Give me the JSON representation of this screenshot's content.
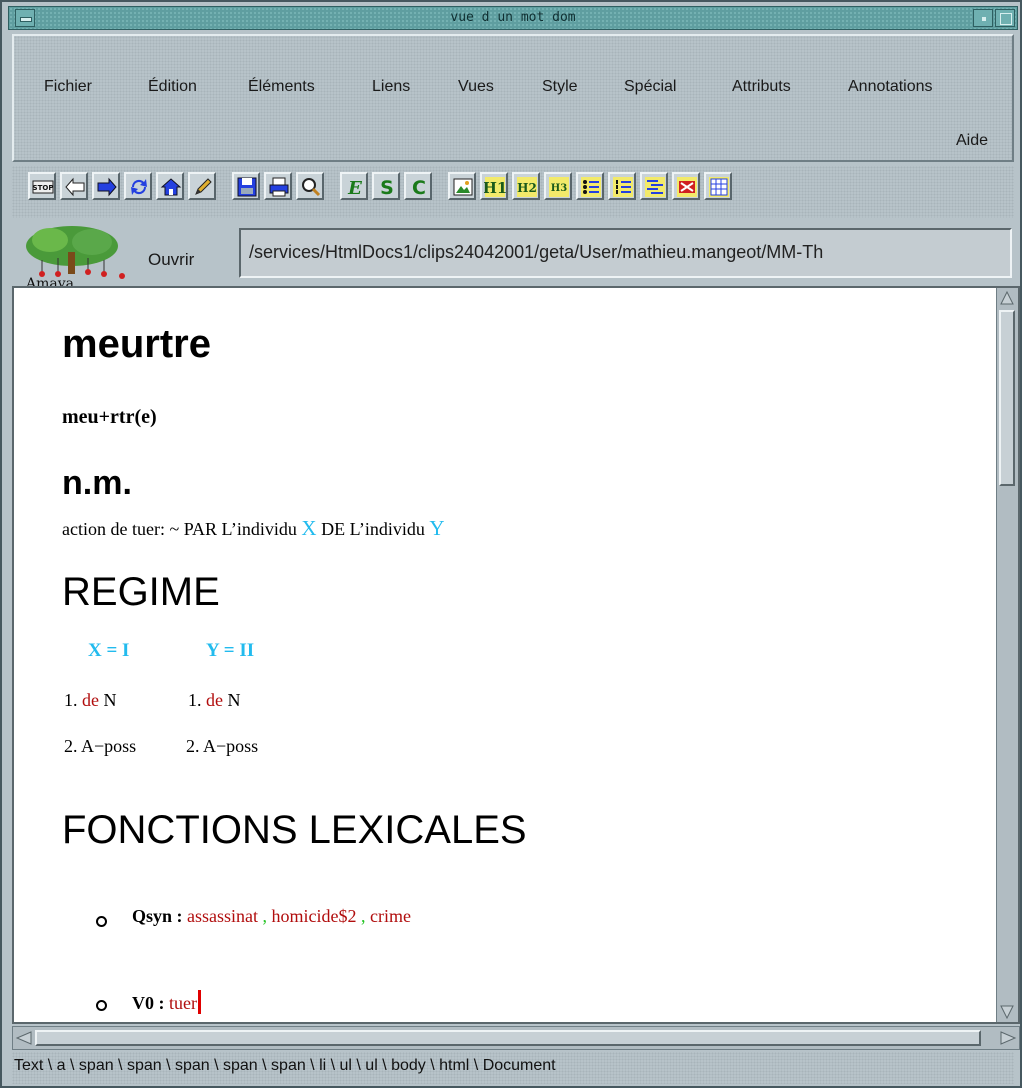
{
  "window": {
    "title": "vue d un mot dom"
  },
  "menubar": {
    "items": [
      "Fichier",
      "Édition",
      "Éléments",
      "Liens",
      "Vues",
      "Style",
      "Spécial",
      "Attributs",
      "Annotations",
      "Aide"
    ]
  },
  "toolbar": {
    "buttons": [
      {
        "icon": "stop-icon",
        "text": "STOP"
      },
      {
        "icon": "back-arrow-icon"
      },
      {
        "icon": "forward-arrow-icon"
      },
      {
        "icon": "reload-icon"
      },
      {
        "icon": "home-icon"
      },
      {
        "icon": "edit-pencil-icon"
      },
      {
        "icon": "save-icon"
      },
      {
        "icon": "print-icon"
      },
      {
        "icon": "find-icon"
      },
      {
        "icon": "emphasis-icon",
        "text": "E"
      },
      {
        "icon": "strong-icon",
        "text": "S"
      },
      {
        "icon": "code-icon",
        "text": "C"
      },
      {
        "icon": "image-icon"
      },
      {
        "icon": "heading1-icon",
        "text": "H1"
      },
      {
        "icon": "heading2-icon",
        "text": "H2"
      },
      {
        "icon": "heading3-icon",
        "text": "H3"
      },
      {
        "icon": "bulleted-list-icon"
      },
      {
        "icon": "numbered-list-icon"
      },
      {
        "icon": "definition-list-icon"
      },
      {
        "icon": "object-icon"
      },
      {
        "icon": "table-icon"
      }
    ]
  },
  "address": {
    "logo_text": "Amaya",
    "open_label": "Ouvrir",
    "url": "/services/HtmlDocs1/clips24042001/geta/User/mathieu.mangeot/MM-Th"
  },
  "document": {
    "headword": "meurtre",
    "pronunciation": "meu+rtr(e)",
    "pos": "n.m.",
    "definition": {
      "prefix": "action de tuer: ~ PAR L’individu ",
      "var_x": "X",
      "middle": " DE L’individu ",
      "var_y": "Y"
    },
    "regime_heading": "REGIME",
    "regime": {
      "x_head": "X = I",
      "y_head": "Y = II",
      "rows": [
        {
          "x_num": "1.",
          "x_prep": "de",
          "x_rest": "N",
          "y_num": "1.",
          "y_prep": "de",
          "y_rest": "N"
        },
        {
          "x_text": "2. A−poss",
          "y_text": "2. A−poss"
        }
      ]
    },
    "lexical_functions_heading": "FONCTIONS LEXICALES",
    "functions": [
      {
        "label": "Qsyn :",
        "values": [
          "assassinat",
          "homicide$2",
          "crime"
        ],
        "separator": " ,"
      },
      {
        "label": "V0 :",
        "values": [
          "tuer"
        ]
      }
    ]
  },
  "statusbar": {
    "path": "Text \\ a \\ span \\ span \\ span \\ span \\ span \\ li \\ ul \\ ul \\ body \\ html \\ Document"
  },
  "colors": {
    "variable": "#22bbee",
    "link_red": "#b10d0d",
    "separator_green": "#22c322",
    "caret": "#e00000",
    "titlebar": "#5f9ea0"
  }
}
